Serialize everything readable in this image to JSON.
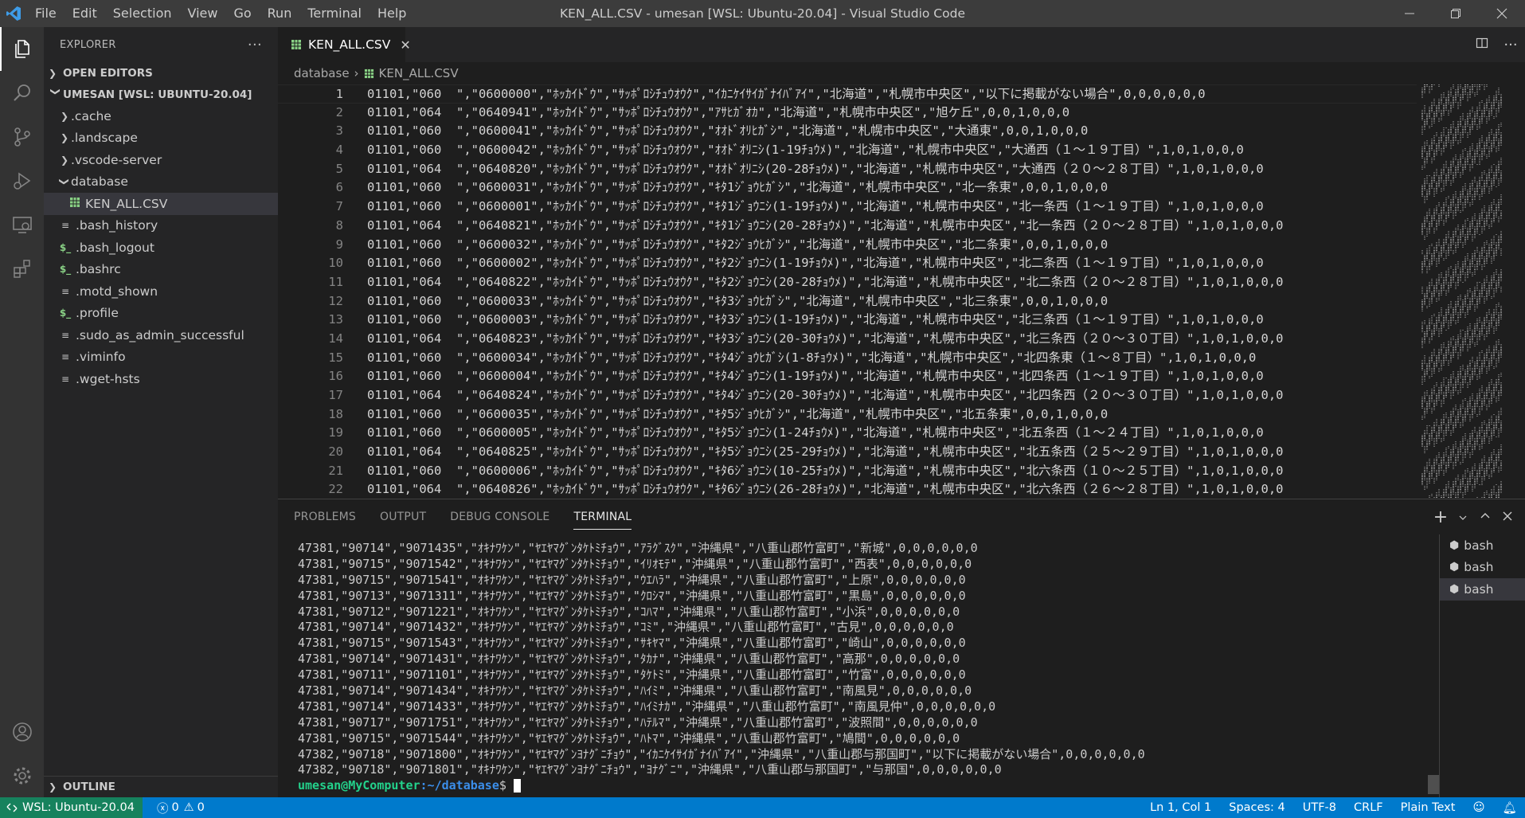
{
  "titlebar": {
    "menu": [
      "File",
      "Edit",
      "Selection",
      "View",
      "Go",
      "Run",
      "Terminal",
      "Help"
    ],
    "title": "KEN_ALL.CSV - umesan [WSL: Ubuntu-20.04] - Visual Studio Code"
  },
  "sidebar": {
    "header": "EXPLORER",
    "more": "···",
    "open_editors": "OPEN EDITORS",
    "workspace": "UMESAN [WSL: UBUNTU-20.04]",
    "items": [
      {
        "label": ".cache",
        "kind": "folder"
      },
      {
        "label": ".landscape",
        "kind": "folder"
      },
      {
        "label": ".vscode-server",
        "kind": "folder"
      },
      {
        "label": "database",
        "kind": "folder-open"
      },
      {
        "label": "KEN_ALL.CSV",
        "kind": "csv"
      },
      {
        "label": ".bash_history",
        "kind": "file"
      },
      {
        "label": ".bash_logout",
        "kind": "shell"
      },
      {
        "label": ".bashrc",
        "kind": "shell"
      },
      {
        "label": ".motd_shown",
        "kind": "file"
      },
      {
        "label": ".profile",
        "kind": "shell"
      },
      {
        "label": ".sudo_as_admin_successful",
        "kind": "file"
      },
      {
        "label": ".viminfo",
        "kind": "file"
      },
      {
        "label": ".wget-hsts",
        "kind": "file"
      }
    ],
    "outline": "OUTLINE"
  },
  "tab": {
    "label": "KEN_ALL.CSV",
    "close": "✕"
  },
  "breadcrumb": {
    "folder": "database",
    "sep": "›",
    "file": "KEN_ALL.CSV"
  },
  "editor": {
    "lines": [
      "01101,\"060  \",\"0600000\",\"ﾎｯｶｲﾄﾞｳ\",\"ｻｯﾎﾟﾛｼﾁｭｳｵｳｸ\",\"ｲｶﾆｹｲｻｲｶﾞﾅｲﾊﾞｱｲ\",\"北海道\",\"札幌市中央区\",\"以下に掲載がない場合\",0,0,0,0,0,0",
      "01101,\"064  \",\"0640941\",\"ﾎｯｶｲﾄﾞｳ\",\"ｻｯﾎﾟﾛｼﾁｭｳｵｳｸ\",\"ｱｻﾋｶﾞｵｶ\",\"北海道\",\"札幌市中央区\",\"旭ケ丘\",0,0,1,0,0,0",
      "01101,\"060  \",\"0600041\",\"ﾎｯｶｲﾄﾞｳ\",\"ｻｯﾎﾟﾛｼﾁｭｳｵｳｸ\",\"ｵｵﾄﾞｵﾘﾋｶﾞｼ\",\"北海道\",\"札幌市中央区\",\"大通東\",0,0,1,0,0,0",
      "01101,\"060  \",\"0600042\",\"ﾎｯｶｲﾄﾞｳ\",\"ｻｯﾎﾟﾛｼﾁｭｳｵｳｸ\",\"ｵｵﾄﾞｵﾘﾆｼ(1-19ﾁｮｳﾒ)\",\"北海道\",\"札幌市中央区\",\"大通西（１～１９丁目）\",1,0,1,0,0,0",
      "01101,\"064  \",\"0640820\",\"ﾎｯｶｲﾄﾞｳ\",\"ｻｯﾎﾟﾛｼﾁｭｳｵｳｸ\",\"ｵｵﾄﾞｵﾘﾆｼ(20-28ﾁｮｳﾒ)\",\"北海道\",\"札幌市中央区\",\"大通西（２０～２８丁目）\",1,0,1,0,0,0",
      "01101,\"060  \",\"0600031\",\"ﾎｯｶｲﾄﾞｳ\",\"ｻｯﾎﾟﾛｼﾁｭｳｵｳｸ\",\"ｷﾀ1ｼﾞｮｳﾋｶﾞｼ\",\"北海道\",\"札幌市中央区\",\"北一条東\",0,0,1,0,0,0",
      "01101,\"060  \",\"0600001\",\"ﾎｯｶｲﾄﾞｳ\",\"ｻｯﾎﾟﾛｼﾁｭｳｵｳｸ\",\"ｷﾀ1ｼﾞｮｳﾆｼ(1-19ﾁｮｳﾒ)\",\"北海道\",\"札幌市中央区\",\"北一条西（１～１９丁目）\",1,0,1,0,0,0",
      "01101,\"064  \",\"0640821\",\"ﾎｯｶｲﾄﾞｳ\",\"ｻｯﾎﾟﾛｼﾁｭｳｵｳｸ\",\"ｷﾀ1ｼﾞｮｳﾆｼ(20-28ﾁｮｳﾒ)\",\"北海道\",\"札幌市中央区\",\"北一条西（２０～２８丁目）\",1,0,1,0,0,0",
      "01101,\"060  \",\"0600032\",\"ﾎｯｶｲﾄﾞｳ\",\"ｻｯﾎﾟﾛｼﾁｭｳｵｳｸ\",\"ｷﾀ2ｼﾞｮｳﾋｶﾞｼ\",\"北海道\",\"札幌市中央区\",\"北二条東\",0,0,1,0,0,0",
      "01101,\"060  \",\"0600002\",\"ﾎｯｶｲﾄﾞｳ\",\"ｻｯﾎﾟﾛｼﾁｭｳｵｳｸ\",\"ｷﾀ2ｼﾞｮｳﾆｼ(1-19ﾁｮｳﾒ)\",\"北海道\",\"札幌市中央区\",\"北二条西（１～１９丁目）\",1,0,1,0,0,0",
      "01101,\"064  \",\"0640822\",\"ﾎｯｶｲﾄﾞｳ\",\"ｻｯﾎﾟﾛｼﾁｭｳｵｳｸ\",\"ｷﾀ2ｼﾞｮｳﾆｼ(20-28ﾁｮｳﾒ)\",\"北海道\",\"札幌市中央区\",\"北二条西（２０～２８丁目）\",1,0,1,0,0,0",
      "01101,\"060  \",\"0600033\",\"ﾎｯｶｲﾄﾞｳ\",\"ｻｯﾎﾟﾛｼﾁｭｳｵｳｸ\",\"ｷﾀ3ｼﾞｮｳﾋｶﾞｼ\",\"北海道\",\"札幌市中央区\",\"北三条東\",0,0,1,0,0,0",
      "01101,\"060  \",\"0600003\",\"ﾎｯｶｲﾄﾞｳ\",\"ｻｯﾎﾟﾛｼﾁｭｳｵｳｸ\",\"ｷﾀ3ｼﾞｮｳﾆｼ(1-19ﾁｮｳﾒ)\",\"北海道\",\"札幌市中央区\",\"北三条西（１～１９丁目）\",1,0,1,0,0,0",
      "01101,\"064  \",\"0640823\",\"ﾎｯｶｲﾄﾞｳ\",\"ｻｯﾎﾟﾛｼﾁｭｳｵｳｸ\",\"ｷﾀ3ｼﾞｮｳﾆｼ(20-30ﾁｮｳﾒ)\",\"北海道\",\"札幌市中央区\",\"北三条西（２０～３０丁目）\",1,0,1,0,0,0",
      "01101,\"060  \",\"0600034\",\"ﾎｯｶｲﾄﾞｳ\",\"ｻｯﾎﾟﾛｼﾁｭｳｵｳｸ\",\"ｷﾀ4ｼﾞｮｳﾋｶﾞｼ(1-8ﾁｮｳﾒ)\",\"北海道\",\"札幌市中央区\",\"北四条東（１～８丁目）\",1,0,1,0,0,0",
      "01101,\"060  \",\"0600004\",\"ﾎｯｶｲﾄﾞｳ\",\"ｻｯﾎﾟﾛｼﾁｭｳｵｳｸ\",\"ｷﾀ4ｼﾞｮｳﾆｼ(1-19ﾁｮｳﾒ)\",\"北海道\",\"札幌市中央区\",\"北四条西（１～１９丁目）\",1,0,1,0,0,0",
      "01101,\"064  \",\"0640824\",\"ﾎｯｶｲﾄﾞｳ\",\"ｻｯﾎﾟﾛｼﾁｭｳｵｳｸ\",\"ｷﾀ4ｼﾞｮｳﾆｼ(20-30ﾁｮｳﾒ)\",\"北海道\",\"札幌市中央区\",\"北四条西（２０～３０丁目）\",1,0,1,0,0,0",
      "01101,\"060  \",\"0600035\",\"ﾎｯｶｲﾄﾞｳ\",\"ｻｯﾎﾟﾛｼﾁｭｳｵｳｸ\",\"ｷﾀ5ｼﾞｮｳﾋｶﾞｼ\",\"北海道\",\"札幌市中央区\",\"北五条東\",0,0,1,0,0,0",
      "01101,\"060  \",\"0600005\",\"ﾎｯｶｲﾄﾞｳ\",\"ｻｯﾎﾟﾛｼﾁｭｳｵｳｸ\",\"ｷﾀ5ｼﾞｮｳﾆｼ(1-24ﾁｮｳﾒ)\",\"北海道\",\"札幌市中央区\",\"北五条西（１～２４丁目）\",1,0,1,0,0,0",
      "01101,\"064  \",\"0640825\",\"ﾎｯｶｲﾄﾞｳ\",\"ｻｯﾎﾟﾛｼﾁｭｳｵｳｸ\",\"ｷﾀ5ｼﾞｮｳﾆｼ(25-29ﾁｮｳﾒ)\",\"北海道\",\"札幌市中央区\",\"北五条西（２５～２９丁目）\",1,0,1,0,0,0",
      "01101,\"060  \",\"0600006\",\"ﾎｯｶｲﾄﾞｳ\",\"ｻｯﾎﾟﾛｼﾁｭｳｵｳｸ\",\"ｷﾀ6ｼﾞｮｳﾆｼ(10-25ﾁｮｳﾒ)\",\"北海道\",\"札幌市中央区\",\"北六条西（１０～２５丁目）\",1,0,1,0,0,0",
      "01101,\"064  \",\"0640826\",\"ﾎｯｶｲﾄﾞｳ\",\"ｻｯﾎﾟﾛｼﾁｭｳｵｳｸ\",\"ｷﾀ6ｼﾞｮｳﾆｼ(26-28ﾁｮｳﾒ)\",\"北海道\",\"札幌市中央区\",\"北六条西（２６～２８丁目）\",1,0,1,0,0,0"
    ]
  },
  "panel": {
    "tabs": [
      "PROBLEMS",
      "OUTPUT",
      "DEBUG CONSOLE",
      "TERMINAL"
    ],
    "active_tab": "TERMINAL",
    "terminal_lines": [
      "47381,\"90714\",\"9071435\",\"ｵｷﾅﾜｹﾝ\",\"ﾔｴﾔﾏｸﾞﾝﾀｹﾄﾐﾁｮｳ\",\"ｱﾗｸﾞｽｸ\",\"沖縄県\",\"八重山郡竹富町\",\"新城\",0,0,0,0,0,0",
      "47381,\"90715\",\"9071542\",\"ｵｷﾅﾜｹﾝ\",\"ﾔｴﾔﾏｸﾞﾝﾀｹﾄﾐﾁｮｳ\",\"ｲﾘｵﾓﾃ\",\"沖縄県\",\"八重山郡竹富町\",\"西表\",0,0,0,0,0,0",
      "47381,\"90715\",\"9071541\",\"ｵｷﾅﾜｹﾝ\",\"ﾔｴﾔﾏｸﾞﾝﾀｹﾄﾐﾁｮｳ\",\"ｳｴﾊﾗ\",\"沖縄県\",\"八重山郡竹富町\",\"上原\",0,0,0,0,0,0",
      "47381,\"90713\",\"9071311\",\"ｵｷﾅﾜｹﾝ\",\"ﾔｴﾔﾏｸﾞﾝﾀｹﾄﾐﾁｮｳ\",\"ｸﾛｼﾏ\",\"沖縄県\",\"八重山郡竹富町\",\"黒島\",0,0,0,0,0,0",
      "47381,\"90712\",\"9071221\",\"ｵｷﾅﾜｹﾝ\",\"ﾔｴﾔﾏｸﾞﾝﾀｹﾄﾐﾁｮｳ\",\"ｺﾊﾏ\",\"沖縄県\",\"八重山郡竹富町\",\"小浜\",0,0,0,0,0,0",
      "47381,\"90714\",\"9071432\",\"ｵｷﾅﾜｹﾝ\",\"ﾔｴﾔﾏｸﾞﾝﾀｹﾄﾐﾁｮｳ\",\"ｺﾐ\",\"沖縄県\",\"八重山郡竹富町\",\"古見\",0,0,0,0,0,0",
      "47381,\"90715\",\"9071543\",\"ｵｷﾅﾜｹﾝ\",\"ﾔｴﾔﾏｸﾞﾝﾀｹﾄﾐﾁｮｳ\",\"ｻｷﾔﾏ\",\"沖縄県\",\"八重山郡竹富町\",\"崎山\",0,0,0,0,0,0",
      "47381,\"90714\",\"9071431\",\"ｵｷﾅﾜｹﾝ\",\"ﾔｴﾔﾏｸﾞﾝﾀｹﾄﾐﾁｮｳ\",\"ﾀｶﾅ\",\"沖縄県\",\"八重山郡竹富町\",\"高那\",0,0,0,0,0,0",
      "47381,\"90711\",\"9071101\",\"ｵｷﾅﾜｹﾝ\",\"ﾔｴﾔﾏｸﾞﾝﾀｹﾄﾐﾁｮｳ\",\"ﾀｹﾄﾐ\",\"沖縄県\",\"八重山郡竹富町\",\"竹富\",0,0,0,0,0,0",
      "47381,\"90714\",\"9071434\",\"ｵｷﾅﾜｹﾝ\",\"ﾔｴﾔﾏｸﾞﾝﾀｹﾄﾐﾁｮｳ\",\"ﾊｲﾐ\",\"沖縄県\",\"八重山郡竹富町\",\"南風見\",0,0,0,0,0,0",
      "47381,\"90714\",\"9071433\",\"ｵｷﾅﾜｹﾝ\",\"ﾔｴﾔﾏｸﾞﾝﾀｹﾄﾐﾁｮｳ\",\"ﾊｲﾐﾅｶ\",\"沖縄県\",\"八重山郡竹富町\",\"南風見仲\",0,0,0,0,0,0",
      "47381,\"90717\",\"9071751\",\"ｵｷﾅﾜｹﾝ\",\"ﾔｴﾔﾏｸﾞﾝﾀｹﾄﾐﾁｮｳ\",\"ﾊﾃﾙﾏ\",\"沖縄県\",\"八重山郡竹富町\",\"波照間\",0,0,0,0,0,0",
      "47381,\"90715\",\"9071544\",\"ｵｷﾅﾜｹﾝ\",\"ﾔｴﾔﾏｸﾞﾝﾀｹﾄﾐﾁｮｳ\",\"ﾊﾄﾏ\",\"沖縄県\",\"八重山郡竹富町\",\"鳩間\",0,0,0,0,0,0",
      "47382,\"90718\",\"9071800\",\"ｵｷﾅﾜｹﾝ\",\"ﾔｴﾔﾏｸﾞﾝﾖﾅｸﾞﾆﾁｮｳ\",\"ｲｶﾆｹｲｻｲｶﾞﾅｲﾊﾞｱｲ\",\"沖縄県\",\"八重山郡与那国町\",\"以下に掲載がない場合\",0,0,0,0,0,0",
      "47382,\"90718\",\"9071801\",\"ｵｷﾅﾜｹﾝ\",\"ﾔｴﾔﾏｸﾞﾝﾖﾅｸﾞﾆﾁｮｳ\",\"ﾖﾅｸﾞﾆ\",\"沖縄県\",\"八重山郡与那国町\",\"与那国\",0,0,0,0,0,0"
    ],
    "prompt_user": "umesan@MyComputer",
    "prompt_path": ":~/database",
    "prompt_symbol": "$ ",
    "terminals": [
      "bash",
      "bash",
      "bash"
    ]
  },
  "statusbar": {
    "remote": "WSL: Ubuntu-20.04",
    "errors": "0",
    "warnings": "0",
    "position": "Ln 1, Col 1",
    "spaces": "Spaces: 4",
    "encoding": "UTF-8",
    "eol": "CRLF",
    "language": "Plain Text"
  },
  "colors": {
    "accent": "#007acc",
    "remote": "#16825d",
    "csv_icon": "#89d185",
    "shell_icon": "#89d185",
    "prompt_user": "#23d18b",
    "prompt_path": "#3b8eea"
  }
}
